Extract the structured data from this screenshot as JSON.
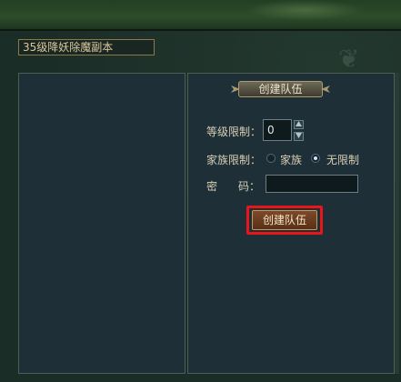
{
  "window": {
    "title": "35级降妖除魔副本"
  },
  "right_panel": {
    "header": "创建队伍",
    "level_label": "等级限制：",
    "level_value": "0",
    "clan_label": "家族限制：",
    "clan_options": [
      "家族",
      "无限制"
    ],
    "clan_selected": "无限制",
    "password_label_a": "密",
    "password_label_b": "码：",
    "password_value": "",
    "create_button": "创建队伍"
  },
  "icons": {
    "spin_up": "triangle-up-icon",
    "spin_down": "triangle-down-icon",
    "wing_left": "ornament-wing-left-icon",
    "wing_right": "ornament-wing-right-icon"
  },
  "colors": {
    "highlight": "#e8151b",
    "panel_bg": "#1e2f38",
    "text": "#d7cfb3"
  }
}
